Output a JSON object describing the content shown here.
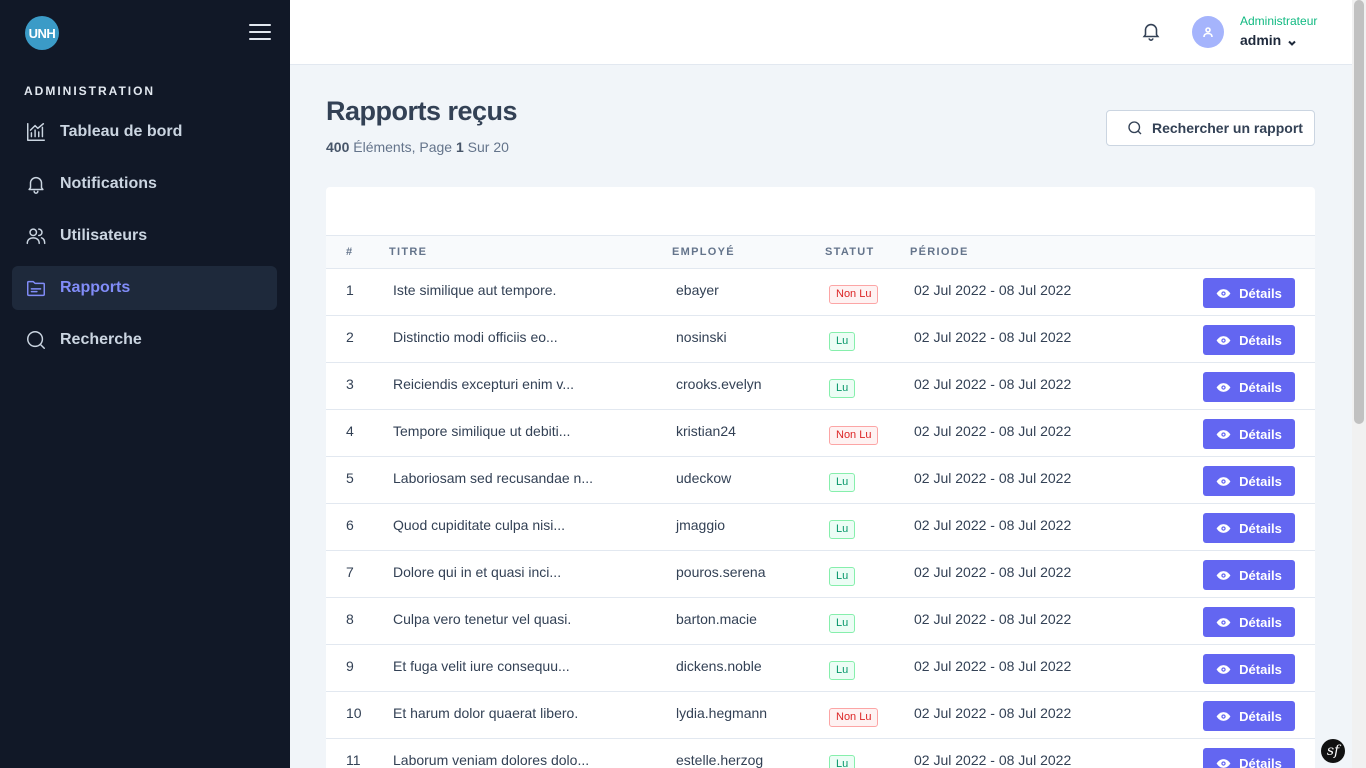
{
  "app": {
    "logo_text": "UNH"
  },
  "sidebar": {
    "section_label": "ADMINISTRATION",
    "items": [
      {
        "label": "Tableau de bord",
        "icon": "chart-icon"
      },
      {
        "label": "Notifications",
        "icon": "bell-icon"
      },
      {
        "label": "Utilisateurs",
        "icon": "users-icon"
      },
      {
        "label": "Rapports",
        "icon": "folder-icon",
        "active": true
      },
      {
        "label": "Recherche",
        "icon": "search-icon"
      }
    ]
  },
  "header": {
    "user_role": "Administrateur",
    "user_name": "admin"
  },
  "page": {
    "title": "Rapports reçus",
    "count": "400",
    "count_suffix": " Éléments, Page ",
    "page_num": "1",
    "page_total": " Sur 20",
    "search_label": "Rechercher un rapport"
  },
  "table": {
    "columns": [
      "#",
      "TITRE",
      "EMPLOYÉ",
      "STATUT",
      "PÉRIODE"
    ],
    "details_label": "Détails",
    "rows": [
      {
        "num": "1",
        "title": "Iste similique aut tempore.",
        "employee": "ebayer",
        "status": "Non Lu",
        "period": "02 Jul 2022 - 08 Jul 2022"
      },
      {
        "num": "2",
        "title": "Distinctio modi officiis eo...",
        "employee": "nosinski",
        "status": "Lu",
        "period": "02 Jul 2022 - 08 Jul 2022"
      },
      {
        "num": "3",
        "title": "Reiciendis excepturi enim v...",
        "employee": "crooks.evelyn",
        "status": "Lu",
        "period": "02 Jul 2022 - 08 Jul 2022"
      },
      {
        "num": "4",
        "title": "Tempore similique ut debiti...",
        "employee": "kristian24",
        "status": "Non Lu",
        "period": "02 Jul 2022 - 08 Jul 2022"
      },
      {
        "num": "5",
        "title": "Laboriosam sed recusandae n...",
        "employee": "udeckow",
        "status": "Lu",
        "period": "02 Jul 2022 - 08 Jul 2022"
      },
      {
        "num": "6",
        "title": "Quod cupiditate culpa nisi...",
        "employee": "jmaggio",
        "status": "Lu",
        "period": "02 Jul 2022 - 08 Jul 2022"
      },
      {
        "num": "7",
        "title": "Dolore qui in et quasi inci...",
        "employee": "pouros.serena",
        "status": "Lu",
        "period": "02 Jul 2022 - 08 Jul 2022"
      },
      {
        "num": "8",
        "title": "Culpa vero tenetur vel quasi.",
        "employee": "barton.macie",
        "status": "Lu",
        "period": "02 Jul 2022 - 08 Jul 2022"
      },
      {
        "num": "9",
        "title": "Et fuga velit iure consequu...",
        "employee": "dickens.noble",
        "status": "Lu",
        "period": "02 Jul 2022 - 08 Jul 2022"
      },
      {
        "num": "10",
        "title": "Et harum dolor quaerat libero.",
        "employee": "lydia.hegmann",
        "status": "Non Lu",
        "period": "02 Jul 2022 - 08 Jul 2022"
      },
      {
        "num": "11",
        "title": "Laborum veniam dolores dolo...",
        "employee": "estelle.herzog",
        "status": "Lu",
        "period": "02 Jul 2022 - 08 Jul 2022"
      }
    ]
  },
  "colors": {
    "sidebar_bg": "#111827",
    "accent": "#6366f1",
    "active_text": "#818cf8",
    "role_text": "#10b981",
    "unread": "#dc2626",
    "read": "#059669"
  },
  "footer": {
    "symfony_badge": "sf"
  }
}
